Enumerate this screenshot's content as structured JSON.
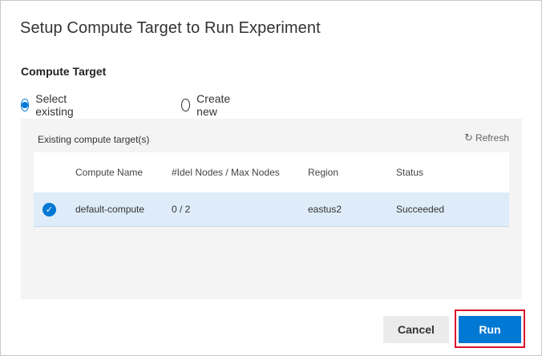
{
  "dialog": {
    "title": "Setup Compute Target to Run Experiment",
    "section_label": "Compute Target",
    "radios": {
      "existing_label": "Select existing",
      "existing_selected": true,
      "new_label": "Create new",
      "new_selected": false
    },
    "panel": {
      "label": "Existing compute target(s)",
      "refresh_label": "Refresh",
      "columns": [
        "Compute Name",
        "#Idel Nodes / Max Nodes",
        "Region",
        "Status"
      ],
      "rows": [
        {
          "name": "default-compute",
          "nodes": "0 / 2",
          "region": "eastus2",
          "status": "Succeeded",
          "selected": true
        }
      ]
    },
    "buttons": {
      "cancel_label": "Cancel",
      "run_label": "Run"
    },
    "colors": {
      "accent": "#0078d4",
      "selected_row": "#deecf9",
      "highlight_border": "#d9112d"
    }
  }
}
